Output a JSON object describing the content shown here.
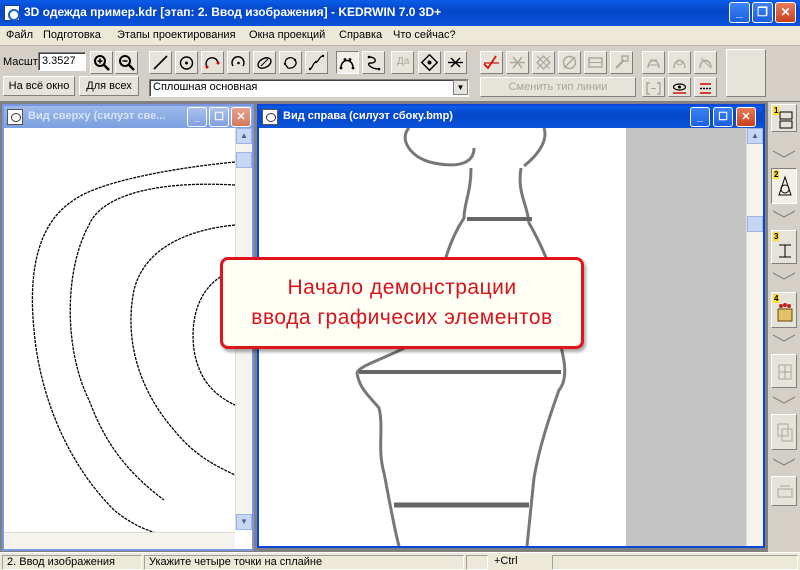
{
  "window": {
    "title": "3D одежда пример.kdr [этап: 2. Ввод изображения] - KEDRWIN 7.0 3D+"
  },
  "menu": [
    "Файл",
    "Подготовка",
    "Этапы проектирования",
    "Окна проекций",
    "Справка",
    "Что сейчас?"
  ],
  "toolbar": {
    "scale_label": "Масшт",
    "scale_value": "3.3527",
    "fit_all_label": "На всё окно",
    "for_all_label": "Для всех",
    "line_type_value": "Сплошная основная",
    "confirm_label": "Да",
    "change_line_type_label": "Сменить тип линии"
  },
  "windows": {
    "top_view": {
      "title": "Вид сверху (силуэт све..."
    },
    "side_view": {
      "title": "Вид справа (силуэт сбоку.bmp)"
    }
  },
  "banner": {
    "line1": "Начало демонстрации",
    "line2": "ввода графичесих элементов"
  },
  "stages": [
    "1",
    "2",
    "3",
    "4"
  ],
  "status": {
    "stage": "2. Ввод изображения",
    "hint": "Укажите четыре точки на сплайне",
    "modifier": "+Ctrl"
  },
  "colors": {
    "accent_red": "#e1141a",
    "title_blue": "#0a53d8"
  }
}
